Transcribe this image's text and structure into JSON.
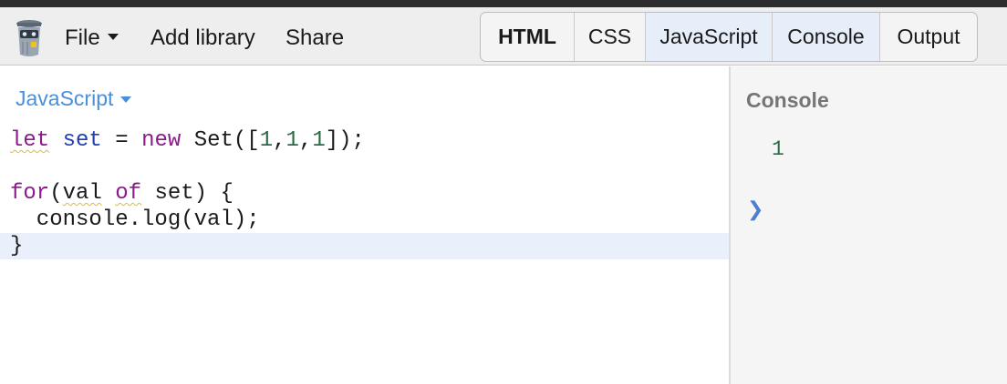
{
  "toolbar": {
    "logo_icon": "trash-can-robot-icon",
    "menu": {
      "file_label": "File",
      "add_library_label": "Add library",
      "share_label": "Share"
    },
    "tabs": [
      {
        "label": "HTML"
      },
      {
        "label": "CSS"
      },
      {
        "label": "JavaScript"
      },
      {
        "label": "Console"
      },
      {
        "label": "Output"
      }
    ]
  },
  "editor": {
    "language_label": "JavaScript",
    "code": {
      "line1": {
        "kw_let": "let",
        "var_set": "set",
        "op_eq": "=",
        "kw_new": "new",
        "fn_set": "Set([",
        "n1": "1",
        "c1": ",",
        "n2": "1",
        "c2": ",",
        "n3": "1",
        "end": "]);"
      },
      "line3": {
        "kw_for": "for",
        "paren": "(",
        "val": "val",
        "kw_of": "of",
        "rest": "set) {"
      },
      "line4": {
        "text": "  console.log(val);"
      },
      "line5": {
        "text": "}"
      }
    }
  },
  "console": {
    "title": "Console",
    "output": "1",
    "prompt_glyph": "❯"
  },
  "colors": {
    "keyword": "#8b1a8b",
    "definition": "#1f3fb0",
    "number": "#2a6b45",
    "link": "#4a90d9",
    "active_tab": "#e6eef9"
  }
}
